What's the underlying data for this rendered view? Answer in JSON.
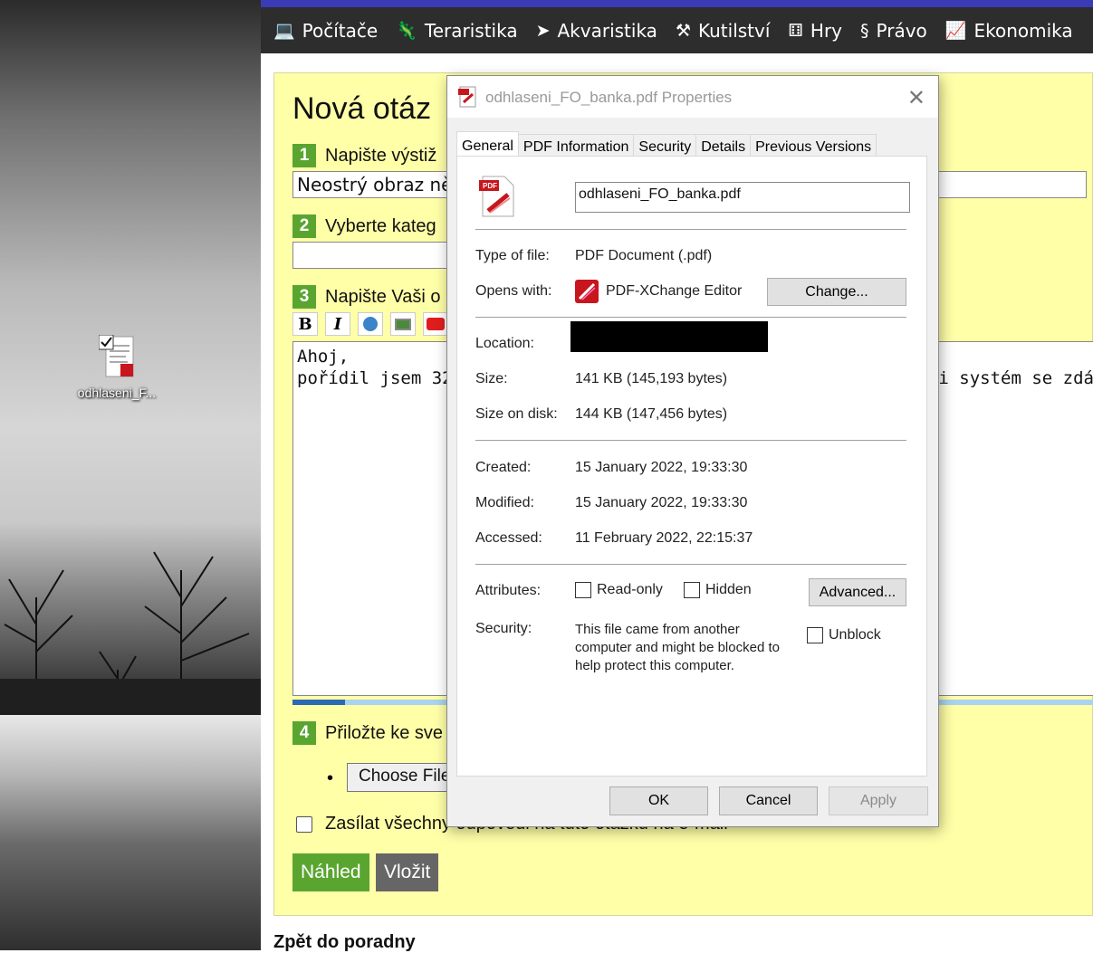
{
  "desktop": {
    "icon_label": "odhlaseni_F..."
  },
  "nav": {
    "items": [
      {
        "label": "Počítače",
        "icon": "computer-icon",
        "glyph": "💻"
      },
      {
        "label": "Teraristika",
        "icon": "lizard-icon",
        "glyph": "🦎"
      },
      {
        "label": "Akvaristika",
        "icon": "fish-icon",
        "glyph": "➤"
      },
      {
        "label": "Kutilství",
        "icon": "tools-icon",
        "glyph": "⚒"
      },
      {
        "label": "Hry",
        "icon": "dice-icon",
        "glyph": "⚅"
      },
      {
        "label": "Právo",
        "icon": "paragraph-icon",
        "glyph": "§"
      },
      {
        "label": "Ekonomika",
        "icon": "chart-icon",
        "glyph": "📈"
      }
    ]
  },
  "form": {
    "title": "Nová otáz",
    "step1": {
      "num": "1",
      "label": "Napište výstiž"
    },
    "subject_value": "Neostrý obraz ně",
    "step2": {
      "num": "2",
      "label": "Vyberte kateg"
    },
    "step3": {
      "num": "3",
      "label": "Napište Vaši o"
    },
    "editor_line1": "Ahoj,",
    "editor_line2_left": "pořídil jsem 32 p",
    "editor_line2_right": "b i systém se zdá",
    "step4": {
      "num": "4",
      "label": "Přiložte ke sve"
    },
    "choose_file": "Choose File",
    "notify_label": "Zasílat všechny odpovědi na tuto otázku na e-mail",
    "preview_button": "Náhled",
    "submit_button": "Vložit",
    "back_link": "Zpět do poradny"
  },
  "dialog": {
    "title": "odhlaseni_FO_banka.pdf Properties",
    "tabs": [
      "General",
      "PDF Information",
      "Security",
      "Details",
      "Previous Versions"
    ],
    "active_tab": "General",
    "filename": "odhlaseni_FO_banka.pdf",
    "type_label": "Type of file:",
    "type_value": "PDF Document (.pdf)",
    "opens_label": "Opens with:",
    "opens_value": "PDF-XChange Editor",
    "change_button": "Change...",
    "location_label": "Location:",
    "size_label": "Size:",
    "size_value": "141 KB (145,193 bytes)",
    "size_disk_label": "Size on disk:",
    "size_disk_value": "144 KB (147,456 bytes)",
    "created_label": "Created:",
    "created_value": "15 January 2022, 19:33:30",
    "modified_label": "Modified:",
    "modified_value": "15 January 2022, 19:33:30",
    "accessed_label": "Accessed:",
    "accessed_value": "11 February 2022, 22:15:37",
    "attributes_label": "Attributes:",
    "readonly_label": "Read-only",
    "hidden_label": "Hidden",
    "advanced_button": "Advanced...",
    "security_label": "Security:",
    "security_line1": "This file came from another",
    "security_line2": "computer and might be blocked to",
    "security_line3": "help protect this computer.",
    "unblock_label": "Unblock",
    "ok_button": "OK",
    "cancel_button": "Cancel",
    "apply_button": "Apply"
  }
}
